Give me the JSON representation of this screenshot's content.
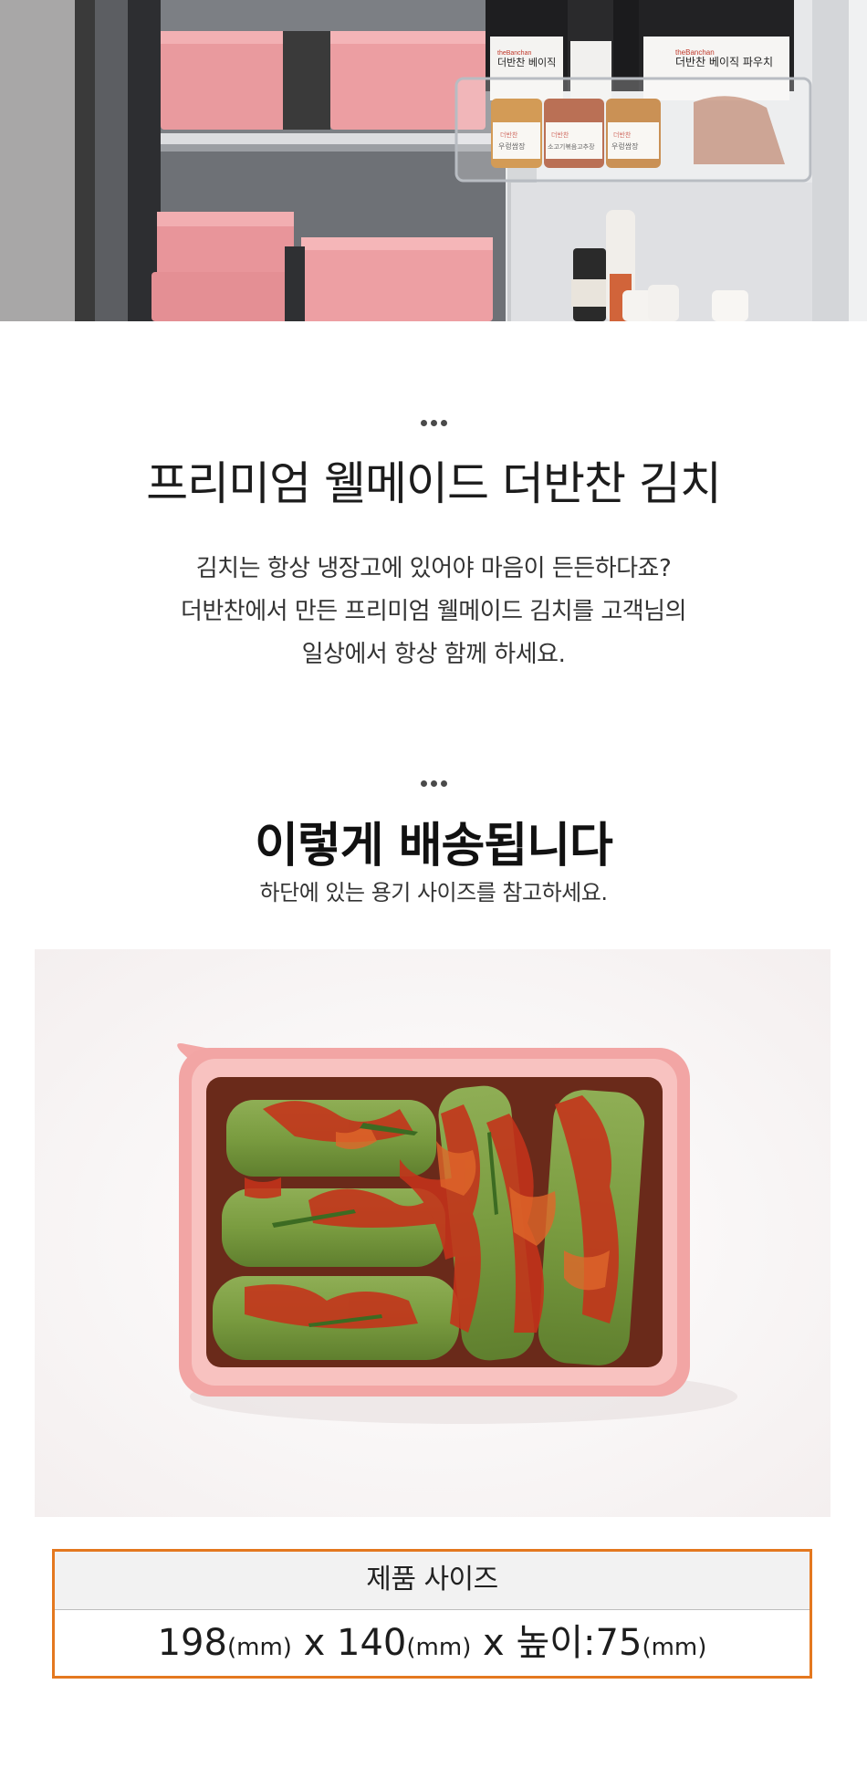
{
  "hero": {
    "brand_text": "theBanchan",
    "shelf_pouch_labels": [
      "더반찬 베이직",
      "더반찬 베이직 파우치"
    ],
    "jar_labels": [
      {
        "brand": "더반찬",
        "name": "우렁쌈장"
      },
      {
        "brand": "더반찬",
        "name": "소고기볶음고추장"
      },
      {
        "brand": "더반찬",
        "name": "우렁쌈장"
      }
    ]
  },
  "intro": {
    "title": "프리미엄 웰메이드 더반찬 김치",
    "lines": [
      "김치는 항상 냉장고에 있어야 마음이 든든하다죠?",
      "더반찬에서 만든 프리미엄 웰메이드 김치를 고객님의",
      "일상에서 항상 함께 하세요."
    ]
  },
  "delivery": {
    "title": "이렇게 배송됩니다",
    "subtitle": "하단에 있는 용기 사이즈를 참고하세요."
  },
  "size_table": {
    "header": "제품 사이즈",
    "width": "198",
    "width_unit": "(mm)",
    "sep1": " x ",
    "depth": "140",
    "depth_unit": "(mm)",
    "sep2": " x ",
    "height_label": "높이:",
    "height": "75",
    "height_unit": "(mm)"
  },
  "colors": {
    "accent_border": "#e4781f",
    "container_pink": "#f2a3a3",
    "table_header_bg": "#f2f2f2"
  }
}
